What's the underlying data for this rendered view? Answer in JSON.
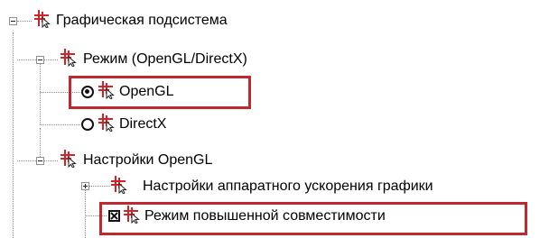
{
  "tree": {
    "items": [
      {
        "label": "Графическая подсистема"
      },
      {
        "label": "Режим (OpenGL/DirectX)"
      },
      {
        "label": "OpenGL",
        "selected": true
      },
      {
        "label": "DirectX",
        "selected": false
      },
      {
        "label": "Настройки OpenGL"
      },
      {
        "label": "Настройки аппаратного ускорения графики"
      },
      {
        "label": "Режим повышенной совместимости",
        "checked": true
      }
    ]
  },
  "colors": {
    "highlight": "#c0282f",
    "icon": "#d2232a"
  }
}
